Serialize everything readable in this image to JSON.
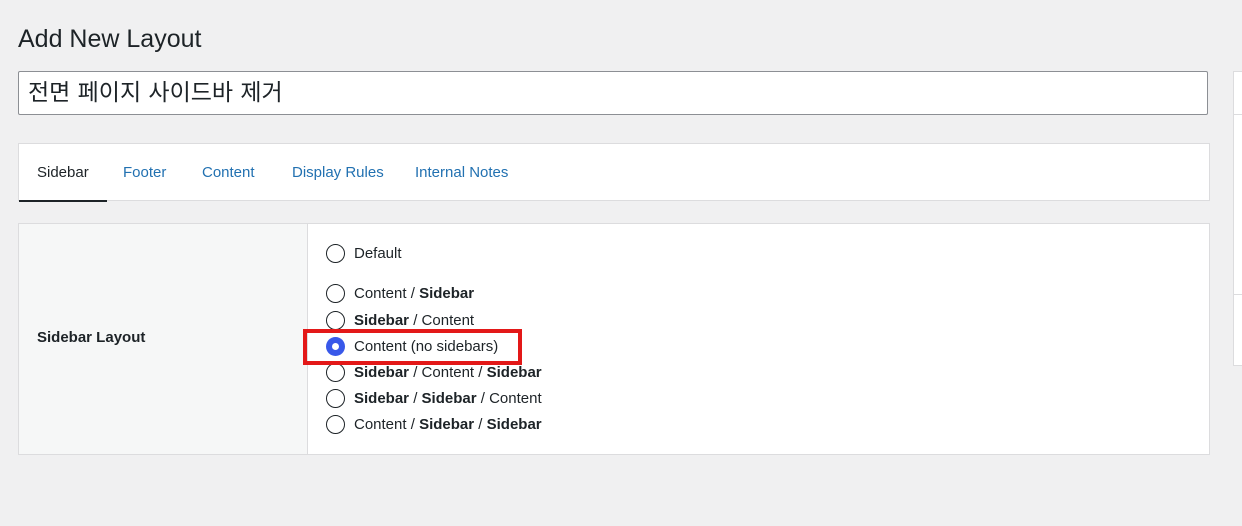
{
  "page": {
    "title": "Add New Layout",
    "layout_name_value": "전면 페이지 사이드바 제거"
  },
  "tabs": [
    {
      "label": "Sidebar",
      "active": true
    },
    {
      "label": "Footer",
      "active": false
    },
    {
      "label": "Content",
      "active": false
    },
    {
      "label": "Display Rules",
      "active": false
    },
    {
      "label": "Internal Notes",
      "active": false
    }
  ],
  "sidebar_layout": {
    "label": "Sidebar Layout",
    "selected": "Content (no sidebars)",
    "options": [
      {
        "parts": [
          "Default"
        ],
        "bold": [
          false
        ]
      },
      {
        "parts": [
          "Content",
          " / ",
          "Sidebar"
        ],
        "bold": [
          false,
          false,
          true
        ]
      },
      {
        "parts": [
          "Sidebar",
          " / ",
          "Content"
        ],
        "bold": [
          true,
          false,
          false
        ]
      },
      {
        "parts": [
          "Content (no sidebars)"
        ],
        "bold": [
          false
        ]
      },
      {
        "parts": [
          "Sidebar",
          " / ",
          "Content",
          " / ",
          "Sidebar"
        ],
        "bold": [
          true,
          false,
          false,
          false,
          true
        ]
      },
      {
        "parts": [
          "Sidebar",
          " / ",
          "Sidebar",
          " / ",
          "Content"
        ],
        "bold": [
          true,
          false,
          true,
          false,
          false
        ]
      },
      {
        "parts": [
          "Content",
          " / ",
          "Sidebar",
          " / ",
          "Sidebar"
        ],
        "bold": [
          false,
          false,
          true,
          false,
          true
        ]
      }
    ]
  },
  "colors": {
    "accent": "#2271b1",
    "radio_checked": "#3858e9",
    "highlight": "#e31818",
    "background": "#f0f0f1"
  }
}
